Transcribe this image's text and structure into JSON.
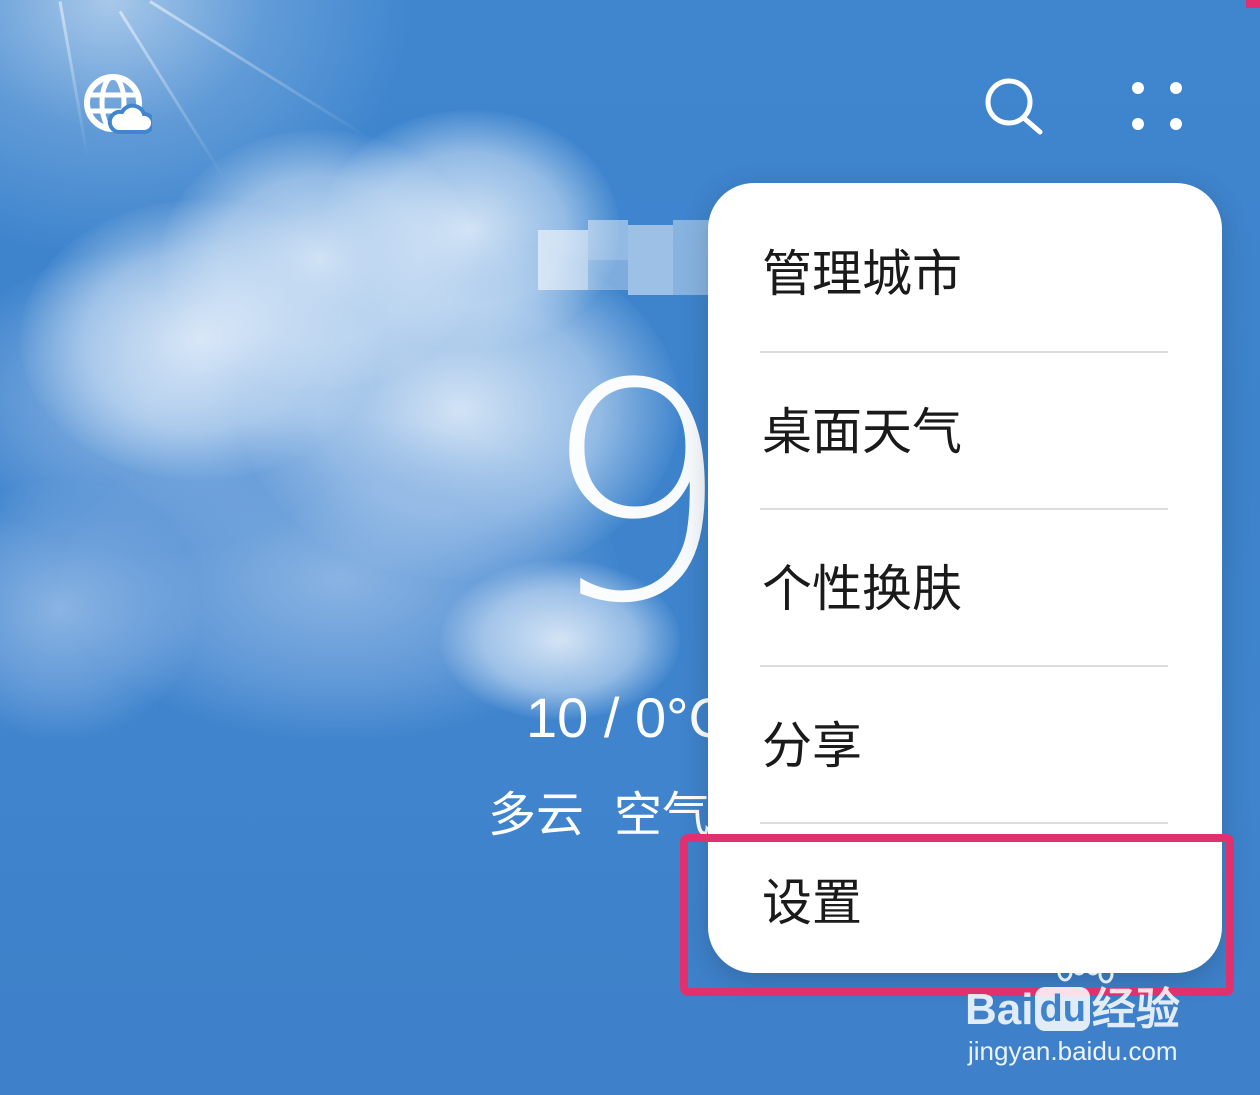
{
  "header": {
    "icons": [
      "globe-cloud-icon",
      "search-icon",
      "more-grid-icon"
    ]
  },
  "weather": {
    "temperature": "9",
    "range": "10 / 0°C",
    "condition": "多云",
    "air_quality_prefix": "空气"
  },
  "menu": {
    "items": [
      {
        "label": "管理城市"
      },
      {
        "label": "桌面天气"
      },
      {
        "label": "个性换肤"
      },
      {
        "label": "分享"
      },
      {
        "label": "设置"
      }
    ],
    "highlighted_index": 4
  },
  "watermark": {
    "logo_left": "Bai",
    "logo_du": "du",
    "logo_right": "经验",
    "url": "jingyan.baidu.com"
  },
  "colors": {
    "sky": "#3f86cf",
    "menu_bg": "#ffffff",
    "highlight": "#e0316e",
    "text_dark": "#1a1a1a"
  }
}
